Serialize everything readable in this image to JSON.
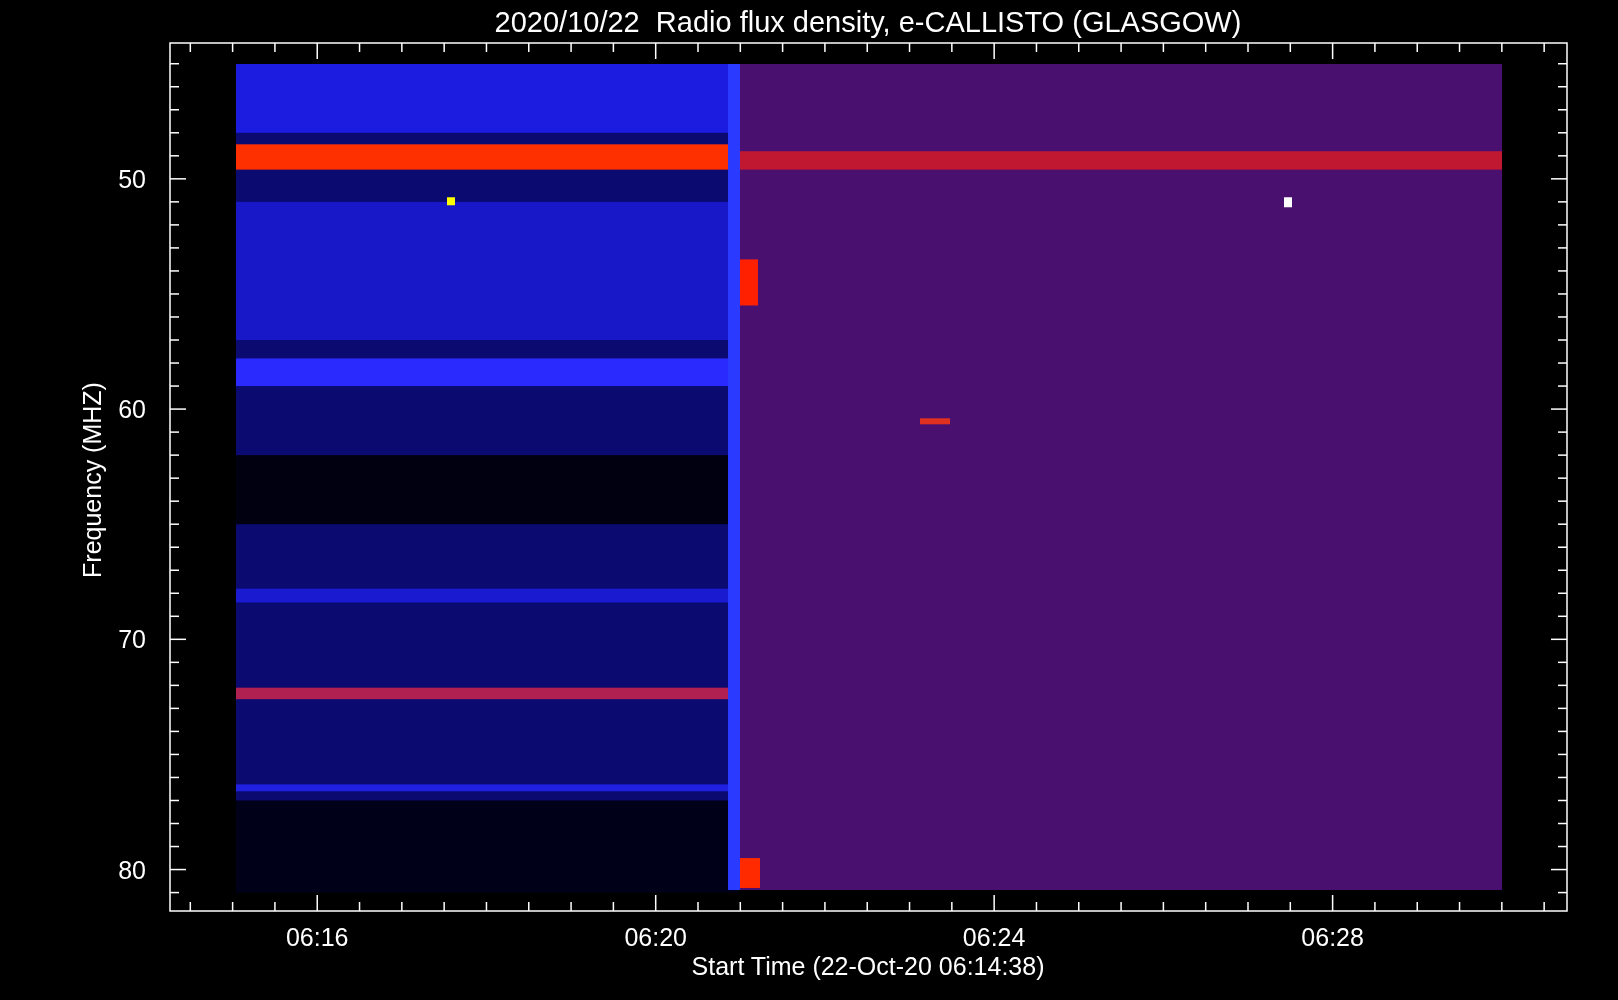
{
  "plot": {
    "title": "2020/10/22  Radio flux density, e-CALLISTO (GLASGOW)",
    "ylabel": "Frequency (MHZ)",
    "xlabel": "Start Time (22-Oct-20 06:14:38)",
    "y_tick_labels": [
      "50",
      "60",
      "70",
      "80"
    ],
    "x_tick_labels": [
      "06:16",
      "06:20",
      "06:24",
      "06:28"
    ]
  }
}
